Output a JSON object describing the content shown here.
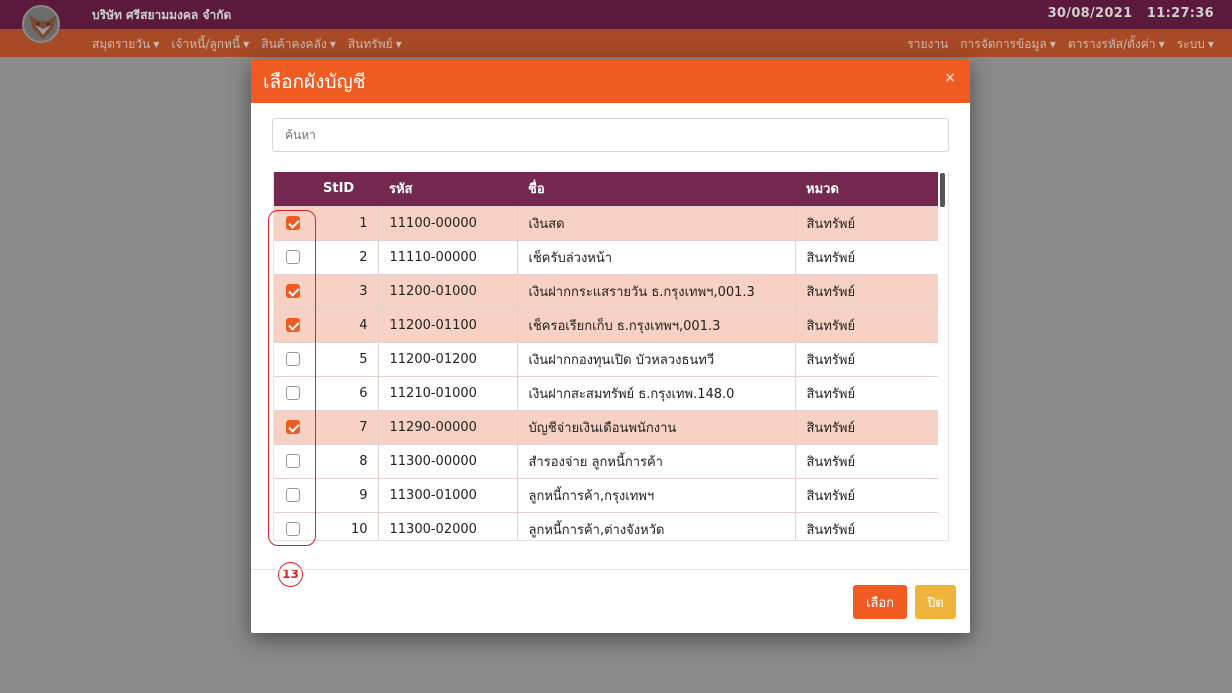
{
  "header": {
    "company": "บริษัท ศรีสยามมงคล จำกัด",
    "date": "30/08/2021",
    "time": "11:27:36"
  },
  "nav": {
    "left": [
      "สมุดรายวัน",
      "เจ้าหนี้/ลูกหนี้",
      "สินค้าคงคลัง",
      "สินทรัพย์"
    ],
    "right": [
      {
        "label": "รายงาน",
        "caret": false
      },
      {
        "label": "การจัดการข้อมูล",
        "caret": true
      },
      {
        "label": "ตารางรหัส/ตั้งค่า",
        "caret": true
      },
      {
        "label": "ระบบ",
        "caret": true
      }
    ]
  },
  "modal": {
    "title": "เลือกผังบัญชี",
    "close_icon": "×",
    "search_placeholder": "ค้นหา",
    "columns": {
      "id": "StID",
      "code": "รหัส",
      "name": "ชื่อ",
      "category": "หมวด"
    },
    "rows": [
      {
        "checked": true,
        "id": "1",
        "code": "11100-00000",
        "name": "เงินสด",
        "category": "สินทรัพย์"
      },
      {
        "checked": false,
        "id": "2",
        "code": "11110-00000",
        "name": "เช็ครับล่วงหน้า",
        "category": "สินทรัพย์"
      },
      {
        "checked": true,
        "id": "3",
        "code": "11200-01000",
        "name": "เงินฝากกระแสรายวัน ธ.กรุงเทพฯ,001.3",
        "category": "สินทรัพย์"
      },
      {
        "checked": true,
        "id": "4",
        "code": "11200-01100",
        "name": "เช็ครอเรียกเก็บ ธ.กรุงเทพฯ,001.3",
        "category": "สินทรัพย์"
      },
      {
        "checked": false,
        "id": "5",
        "code": "11200-01200",
        "name": "เงินฝากกองทุนเปิด บัวหลวงธนทวี",
        "category": "สินทรัพย์"
      },
      {
        "checked": false,
        "id": "6",
        "code": "11210-01000",
        "name": "เงินฝากสะสมทรัพย์ ธ.กรุงเทพ.148.0",
        "category": "สินทรัพย์"
      },
      {
        "checked": true,
        "id": "7",
        "code": "11290-00000",
        "name": "บัญชีจ่ายเงินเดือนพนักงาน",
        "category": "สินทรัพย์"
      },
      {
        "checked": false,
        "id": "8",
        "code": "11300-00000",
        "name": "สำรองจ่าย ลูกหนี้การค้า",
        "category": "สินทรัพย์"
      },
      {
        "checked": false,
        "id": "9",
        "code": "11300-01000",
        "name": "ลูกหนี้การค้า,กรุงเทพฯ",
        "category": "สินทรัพย์"
      },
      {
        "checked": false,
        "id": "10",
        "code": "11300-02000",
        "name": "ลูกหนี้การค้า,ต่างจังหวัด",
        "category": "สินทรัพย์"
      }
    ],
    "callout_number": "13",
    "buttons": {
      "select": "เลือก",
      "close": "ปิด"
    }
  },
  "colors": {
    "accent": "#ef5b20",
    "header_purple": "#74274f",
    "selected_row": "#f7d1c4",
    "close_button": "#f0b43c",
    "callout": "#e02020"
  }
}
